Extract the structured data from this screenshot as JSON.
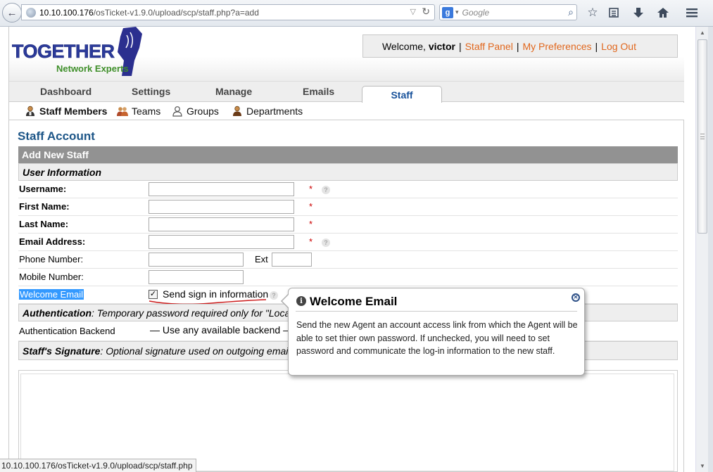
{
  "browser": {
    "url_host": "10.10.100.176",
    "url_path": "/osTicket-v1.9.0/upload/scp/staff.php?a=add",
    "search_placeholder": "Google",
    "status_url": "10.10.100.176/osTicket-v1.9.0/upload/scp/staff.php"
  },
  "header": {
    "logo_main": "TOGETHER",
    "logo_sub": "Network Experts",
    "welcome_prefix": "Welcome, ",
    "username": "victor",
    "links": [
      "Staff Panel",
      "My Preferences",
      "Log Out"
    ]
  },
  "nav": {
    "tabs": [
      "Dashboard",
      "Settings",
      "Manage",
      "Emails",
      "Staff"
    ],
    "active": "Staff"
  },
  "subnav": {
    "items": [
      "Staff Members",
      "Teams",
      "Groups",
      "Departments"
    ],
    "active": "Staff Members"
  },
  "page": {
    "title": "Staff Account",
    "form_header": "Add New Staff",
    "section_user_info": "User Information",
    "fields": {
      "username": "Username:",
      "first_name": "First Name:",
      "last_name": "Last Name:",
      "email": "Email Address:",
      "phone": "Phone Number:",
      "ext": "Ext",
      "mobile": "Mobile Number:",
      "welcome_email": "Welcome Email",
      "send_signin": "Send sign in information"
    },
    "auth_title": "Authentication",
    "auth_desc": ": Temporary password required only for \"Local\" au",
    "auth_backend_label": "Authentication Backend",
    "auth_backend_value": "— Use any available backend —",
    "signature_title": "Staff's Signature",
    "signature_desc": ": Optional signature used on outgoing emails.",
    "required_mark": "*"
  },
  "tooltip": {
    "title": "Welcome Email",
    "body": "Send the new Agent an account access link from which the Agent will be able to set thier own password. If unchecked, you will need to set password and communicate the log-in information to the new staff."
  },
  "colors": {
    "accent_link": "#e1671d",
    "title_blue": "#1c5587",
    "form_header_bg": "#929292",
    "selection": "#3399ff"
  }
}
